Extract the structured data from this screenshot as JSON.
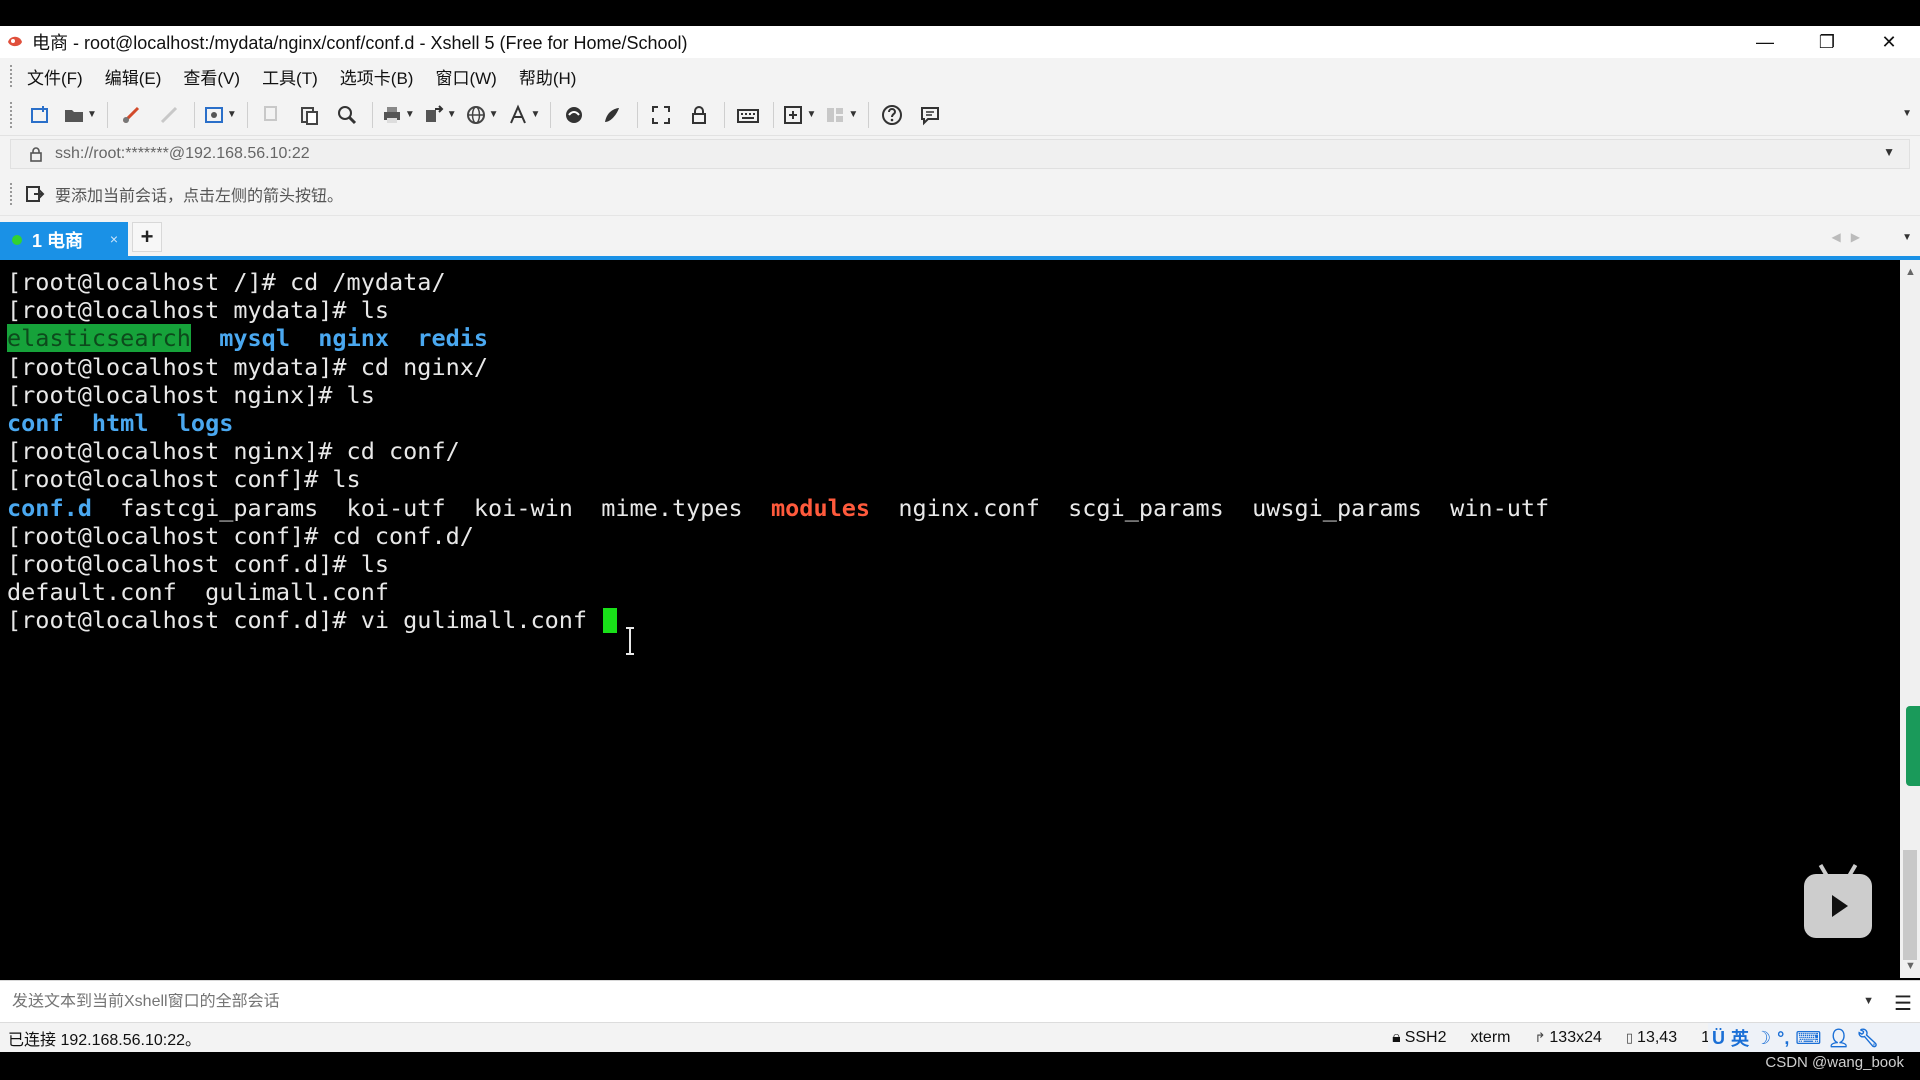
{
  "window": {
    "title": "电商 - root@localhost:/mydata/nginx/conf/conf.d - Xshell 5 (Free for Home/School)",
    "controls": {
      "minimize": "—",
      "restore": "❐",
      "close": "✕"
    }
  },
  "menu": {
    "items": [
      "文件(F)",
      "编辑(E)",
      "查看(V)",
      "工具(T)",
      "选项卡(B)",
      "窗口(W)",
      "帮助(H)"
    ]
  },
  "toolbar": {
    "icons": [
      "new-session-icon",
      "open-folder-icon",
      "connect-icon",
      "disconnect-icon",
      "properties-icon",
      "copy-icon",
      "paste-icon",
      "find-icon",
      "print-icon",
      "transfer-icon",
      "globe-icon",
      "font-icon",
      "xftp-icon",
      "xmanager-icon",
      "fullscreen-icon",
      "lock-icon",
      "keyboard-icon",
      "compose-icon",
      "layout-icon",
      "help-icon",
      "chat-icon"
    ]
  },
  "address": {
    "value": "ssh://root:*******@192.168.56.10:22"
  },
  "session_bar": {
    "hint": "要添加当前会话，点击左侧的箭头按钮。"
  },
  "tabs": {
    "active": {
      "label": "1 电商",
      "close": "×",
      "status_color": "#32d232"
    },
    "add": "+"
  },
  "terminal": {
    "lines": [
      [
        {
          "t": "[root@localhost /]# cd /mydata/",
          "c": "t-prompt"
        }
      ],
      [
        {
          "t": "[root@localhost mydata]# ls",
          "c": "t-prompt"
        }
      ],
      [
        {
          "t": "elasticsearch",
          "c": "t-hl"
        },
        {
          "t": "  ",
          "c": "t-plain"
        },
        {
          "t": "mysql",
          "c": "t-dir"
        },
        {
          "t": "  ",
          "c": "t-plain"
        },
        {
          "t": "nginx",
          "c": "t-dir"
        },
        {
          "t": "  ",
          "c": "t-plain"
        },
        {
          "t": "redis",
          "c": "t-dir"
        }
      ],
      [
        {
          "t": "[root@localhost mydata]# cd nginx/",
          "c": "t-prompt"
        }
      ],
      [
        {
          "t": "[root@localhost nginx]# ls",
          "c": "t-prompt"
        }
      ],
      [
        {
          "t": "conf",
          "c": "t-dir"
        },
        {
          "t": "  ",
          "c": "t-plain"
        },
        {
          "t": "html",
          "c": "t-dir"
        },
        {
          "t": "  ",
          "c": "t-plain"
        },
        {
          "t": "logs",
          "c": "t-dir"
        }
      ],
      [
        {
          "t": "[root@localhost nginx]# cd conf/",
          "c": "t-prompt"
        }
      ],
      [
        {
          "t": "[root@localhost conf]# ls",
          "c": "t-prompt"
        }
      ],
      [
        {
          "t": "conf.d",
          "c": "t-dir"
        },
        {
          "t": "  fastcgi_params  koi-utf  koi-win  mime.types  ",
          "c": "t-plain"
        },
        {
          "t": "modules",
          "c": "t-red"
        },
        {
          "t": "  nginx.conf  scgi_params  uwsgi_params  win-utf",
          "c": "t-plain"
        }
      ],
      [
        {
          "t": "[root@localhost conf]# cd conf.d/",
          "c": "t-prompt"
        }
      ],
      [
        {
          "t": "[root@localhost conf.d]# ls",
          "c": "t-prompt"
        }
      ],
      [
        {
          "t": "default.conf  gulimall.conf",
          "c": "t-plain"
        }
      ],
      [
        {
          "t": "[root@localhost conf.d]# vi gulimall.conf ",
          "c": "t-prompt"
        },
        {
          "t": "",
          "c": "t-cursor"
        }
      ]
    ]
  },
  "send_bar": {
    "placeholder": "发送文本到当前Xshell窗口的全部会话"
  },
  "status": {
    "connection": "已连接 192.168.56.10:22。",
    "protocol": "SSH2",
    "term": "xterm",
    "size": "133x24",
    "position": "13,43",
    "extra": "1"
  },
  "ime": {
    "lang": "英"
  },
  "watermark": "CSDN @wang_book",
  "colors": {
    "accent": "#1a91e6",
    "terminal_bg": "#000000",
    "dir": "#4aa8f0",
    "highlight_dir": "#16a23a",
    "special": "#ff5a3c",
    "cursor": "#19e019"
  }
}
